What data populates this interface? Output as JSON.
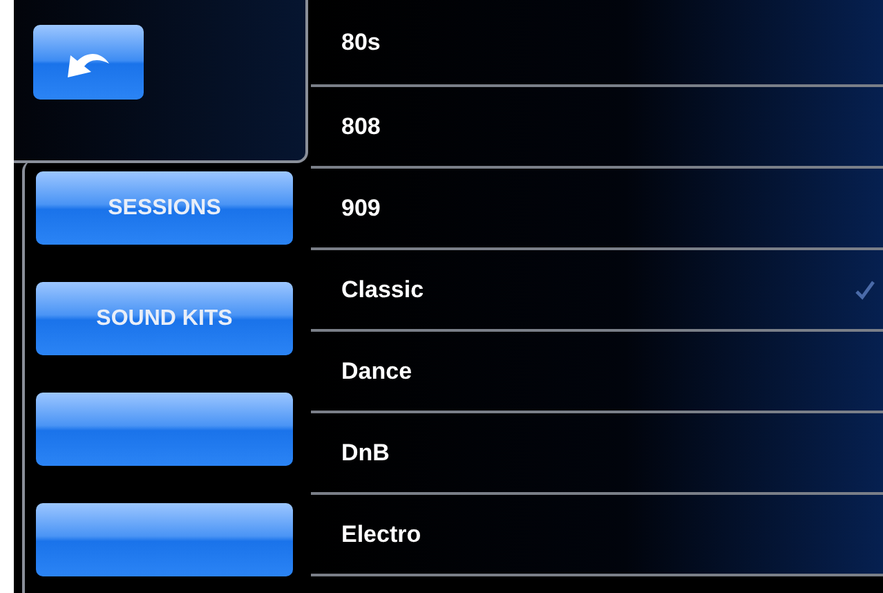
{
  "nav_buttons": [
    {
      "kind": "label",
      "label": "SESSIONS"
    },
    {
      "kind": "label",
      "label": "SOUND KITS"
    },
    {
      "kind": "blank"
    },
    {
      "kind": "blank"
    }
  ],
  "kits": [
    {
      "name": "80s",
      "selected": false
    },
    {
      "name": "808",
      "selected": false
    },
    {
      "name": "909",
      "selected": false
    },
    {
      "name": "Classic",
      "selected": true
    },
    {
      "name": "Dance",
      "selected": false
    },
    {
      "name": "DnB",
      "selected": false
    },
    {
      "name": "Electro",
      "selected": false
    }
  ]
}
